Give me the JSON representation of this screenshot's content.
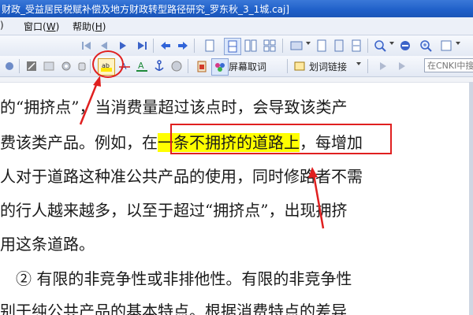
{
  "window": {
    "title": "财政_受益居民税赋补偿及地方财政转型路径研究_罗东秋_3_1城.caj]"
  },
  "menubar": {
    "fragment": ")",
    "items": [
      {
        "label": "窗口(",
        "key": "W",
        "close": ")"
      },
      {
        "label": "帮助(",
        "key": "H",
        "close": ")"
      }
    ]
  },
  "toolbar2": {
    "screen_capture_label": "屏幕取词",
    "word_link_label": "划词链接",
    "cnki_search_placeholder": "在CNKI中搜"
  },
  "document": {
    "lines": [
      {
        "text": "的“拥挤点”，当消费量超过该点时，会导致该类产"
      },
      {
        "before": "费该类产品。例如，",
        "mid": "在",
        "highlight": "一条不拥挤的道路上",
        "after": "，每增加"
      },
      {
        "text": "人对于道路这种准公共产品的使用，同时修路者不需"
      },
      {
        "text": "的行人越来越多，以至于超过“拥挤点”，出现拥挤"
      },
      {
        "text": "用这条道路。"
      },
      {
        "text": "　② 有限的非竞争性或非排他性。有限的非竞争性"
      },
      {
        "text": "别于纯公共产品的基本特点。根据消费特点的差异"
      }
    ]
  },
  "colors": {
    "highlight": "#ffff00",
    "annotation": "#e02020"
  }
}
